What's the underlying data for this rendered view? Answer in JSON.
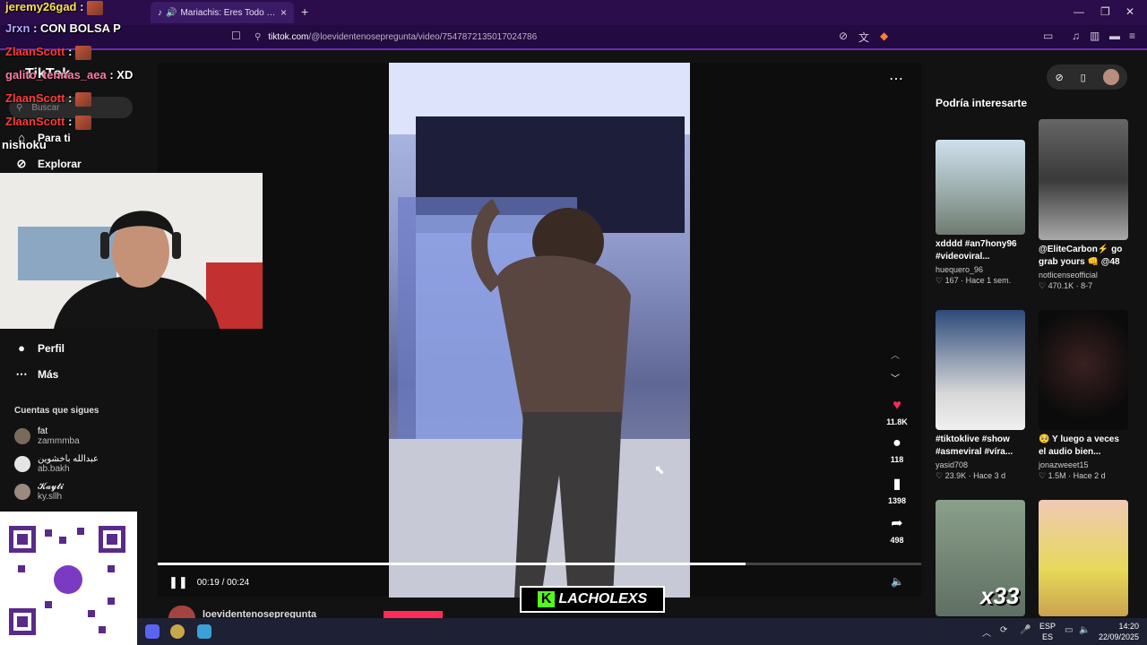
{
  "browser": {
    "tab_title": "Mariachis: Eres Todo en Mi - ...",
    "url_host": "tiktok.com",
    "url_path": "/@loevidentenosepregunta/video/7547872135017024786"
  },
  "chat": [
    {
      "user": "jeremy26gad",
      "sep": " :",
      "msg": ""
    },
    {
      "user": "Jrxn",
      "sep": " :",
      "msg": " CON BOLSA P"
    },
    {
      "user": "ZlaanScott",
      "sep": " :",
      "msg": ""
    },
    {
      "user": "galito_tennas_aea",
      "sep": " :",
      "msg": " XD"
    },
    {
      "user": "ZlaanScott",
      "sep": " :",
      "msg": ""
    },
    {
      "user": "ZlaanScott",
      "sep": " :",
      "msg": ""
    },
    {
      "user": "nishoku",
      "sep": "",
      "msg": ""
    }
  ],
  "sidebar": {
    "logo": "TikTok",
    "search_placeholder": "Buscar",
    "nav": [
      {
        "label": "Para ti",
        "icon": "home-icon"
      },
      {
        "label": "Explorar",
        "icon": "compass-icon"
      },
      {
        "label": "Perfil",
        "icon": "profile-icon"
      },
      {
        "label": "Más",
        "icon": "more-icon"
      }
    ],
    "following_title": "Cuentas que sigues",
    "following": [
      {
        "name": "fat",
        "handle": "zammmba"
      },
      {
        "name": "عبدالله باخشوين",
        "handle": "ab.bakh"
      },
      {
        "name": "𝓚𝓪𝔂𝓽𝓲",
        "handle": "ky.sllh"
      }
    ]
  },
  "player": {
    "time_current": "00:19",
    "time_total": "00:24",
    "progress": 0.77,
    "author": "loevidentenosepregunta",
    "likes": "11.8K",
    "comments": "118",
    "saves": "1398",
    "shares": "498"
  },
  "recommended": {
    "title": "Podría interesarte",
    "cards": [
      {
        "desc": "xdddd #an7hony96 #videoviral...",
        "author": "huequero_96",
        "meta": "♡ 167 · Hace 1 sem."
      },
      {
        "desc": "@EliteCarbon⚡ go grab yours 👊 @48",
        "author": "notlicenseofficial",
        "meta": "♡ 470.1K · 8-7"
      },
      {
        "desc": "#tiktoklive #show #asmeviral #víra...",
        "author": "yasid708",
        "meta": "♡ 23.9K · Hace 3 d"
      },
      {
        "desc": "🥺 Y luego a veces el audio bien...",
        "author": "jonazweeet15",
        "meta": "♡ 1.5M · Hace 2 d"
      }
    ]
  },
  "overlay": {
    "watermark_k": "K",
    "watermark_text": "LACHOLEXS",
    "multiplier": "x33"
  },
  "taskbar": {
    "lang1": "ESP",
    "lang2": "ES",
    "time": "14:20",
    "date": "22/09/2025"
  }
}
